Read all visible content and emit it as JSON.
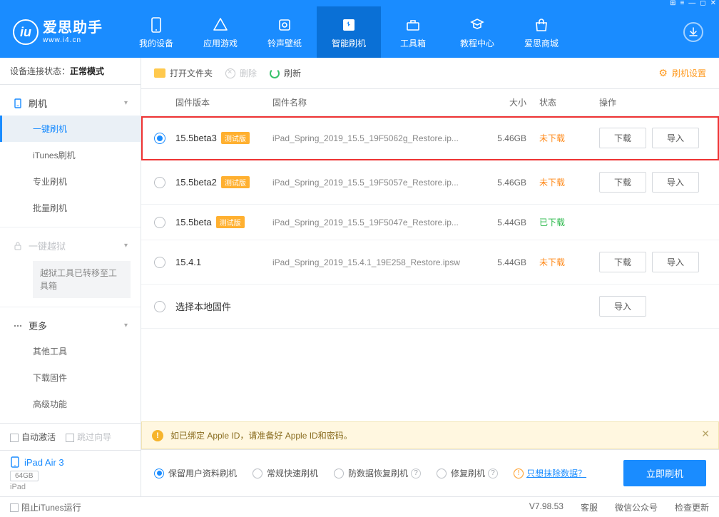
{
  "titlebar_icons": [
    "⊞",
    "≡",
    "—",
    "◻",
    "✕"
  ],
  "logo": {
    "main": "爱思助手",
    "sub": "www.i4.cn",
    "mark": "iu"
  },
  "nav": [
    {
      "id": "my-device",
      "label": "我的设备"
    },
    {
      "id": "app-games",
      "label": "应用游戏"
    },
    {
      "id": "ringtones",
      "label": "铃声壁纸"
    },
    {
      "id": "smart-flash",
      "label": "智能刷机",
      "active": true
    },
    {
      "id": "toolbox",
      "label": "工具箱"
    },
    {
      "id": "tutorial",
      "label": "教程中心"
    },
    {
      "id": "mall",
      "label": "爱思商城"
    }
  ],
  "conn_status": {
    "prefix": "设备连接状态：",
    "value": "正常模式"
  },
  "sidebar": {
    "group1": {
      "head": "刷机",
      "items": [
        "一键刷机",
        "iTunes刷机",
        "专业刷机",
        "批量刷机"
      ]
    },
    "group2": {
      "head": "一键越狱",
      "note": "越狱工具已转移至工具箱"
    },
    "group3": {
      "head": "更多",
      "items": [
        "其他工具",
        "下载固件",
        "高级功能"
      ]
    }
  },
  "bottom": {
    "auto_activate": "自动激活",
    "skip_guide": "跳过向导"
  },
  "device": {
    "name": "iPad Air 3",
    "storage": "64GB",
    "model": "iPad"
  },
  "toolbar_items": {
    "open_folder": "打开文件夹",
    "delete": "删除",
    "refresh": "刷新",
    "settings": "刷机设置"
  },
  "columns": {
    "version": "固件版本",
    "name": "固件名称",
    "size": "大小",
    "status": "状态",
    "action": "操作"
  },
  "beta_tag": "测试版",
  "rows": [
    {
      "version": "15.5beta3",
      "beta": true,
      "name": "iPad_Spring_2019_15.5_19F5062g_Restore.ip...",
      "size": "5.46GB",
      "status": "未下载",
      "status_cls": "status-undl",
      "selected": true,
      "highlight": true,
      "download": true,
      "import": true
    },
    {
      "version": "15.5beta2",
      "beta": true,
      "name": "iPad_Spring_2019_15.5_19F5057e_Restore.ip...",
      "size": "5.46GB",
      "status": "未下载",
      "status_cls": "status-undl",
      "download": true,
      "import": true
    },
    {
      "version": "15.5beta",
      "beta": true,
      "name": "iPad_Spring_2019_15.5_19F5047e_Restore.ip...",
      "size": "5.44GB",
      "status": "已下载",
      "status_cls": "status-dl"
    },
    {
      "version": "15.4.1",
      "beta": false,
      "name": "iPad_Spring_2019_15.4.1_19E258_Restore.ipsw",
      "size": "5.44GB",
      "status": "未下载",
      "status_cls": "status-undl",
      "download": true,
      "import": true
    },
    {
      "version": "选择本地固件",
      "local": true,
      "import": true
    }
  ],
  "buttons": {
    "download": "下载",
    "import": "导入"
  },
  "banner": "如已绑定 Apple ID，请准备好 Apple ID和密码。",
  "flash_opts": [
    {
      "label": "保留用户资料刷机",
      "selected": true
    },
    {
      "label": "常规快速刷机"
    },
    {
      "label": "防数据恢复刷机",
      "help": true
    },
    {
      "label": "修复刷机",
      "help": true
    }
  ],
  "erase_link": "只想抹除数据？",
  "flash_button": "立即刷机",
  "statusbar": {
    "block_itunes": "阻止iTunes运行",
    "version": "V7.98.53",
    "links": [
      "客服",
      "微信公众号",
      "检查更新"
    ]
  }
}
